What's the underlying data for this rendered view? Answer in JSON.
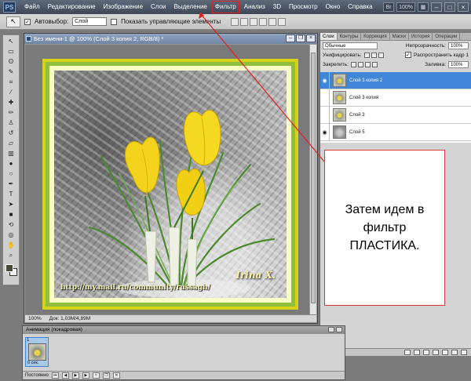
{
  "app": {
    "logo_text": "PS"
  },
  "menu": {
    "items": [
      "Файл",
      "Редактирование",
      "Изображение",
      "Слои",
      "Выделение",
      "Фильтр",
      "Анализ",
      "3D",
      "Просмотр",
      "Окно",
      "Справка"
    ],
    "highlighted": "Фильтр",
    "zoom_value": "100%"
  },
  "options_bar": {
    "autoselect_label": "Автовыбор:",
    "autoselect_value": "Слой",
    "show_controls_label": "Показать управляющие элементы"
  },
  "document": {
    "title": "Без имени-1 @ 100% (Слой 3 копия 2, RGB/8) *",
    "status_zoom": "100%",
    "status_doc": "Док: 1,03М/4,89М",
    "artwork_url": "http://my.mail.ru/community/russagh/",
    "artwork_signature": "Irina X."
  },
  "layers_panel": {
    "tabs": [
      "Слои",
      "Контуры",
      "Коррекция",
      "Маски",
      "История",
      "Операции"
    ],
    "active_tab": "Слои",
    "blend_mode": "Обычные",
    "opacity_label": "Непрозрачность:",
    "opacity_value": "100%",
    "unify_label": "Унифицировать:",
    "propagate_label": "Распространить кадр 1",
    "lock_label": "Закрепить:",
    "fill_label": "Заливка:",
    "fill_value": "100%",
    "layers": [
      {
        "name": "Слой 3 копия 2",
        "visible": true,
        "selected": true
      },
      {
        "name": "Слой 3 копия",
        "visible": false,
        "selected": false
      },
      {
        "name": "Слой 3",
        "visible": false,
        "selected": false
      },
      {
        "name": "Слой 5",
        "visible": true,
        "selected": false
      }
    ]
  },
  "annotation": {
    "text": "Затем идем в\nфильтр\nПЛАСТИКА."
  },
  "animation_panel": {
    "title": "Анимация (покадровая)",
    "frame_number": "1",
    "frame_time": "0 сек.",
    "loop_value": "Постоянно"
  }
}
